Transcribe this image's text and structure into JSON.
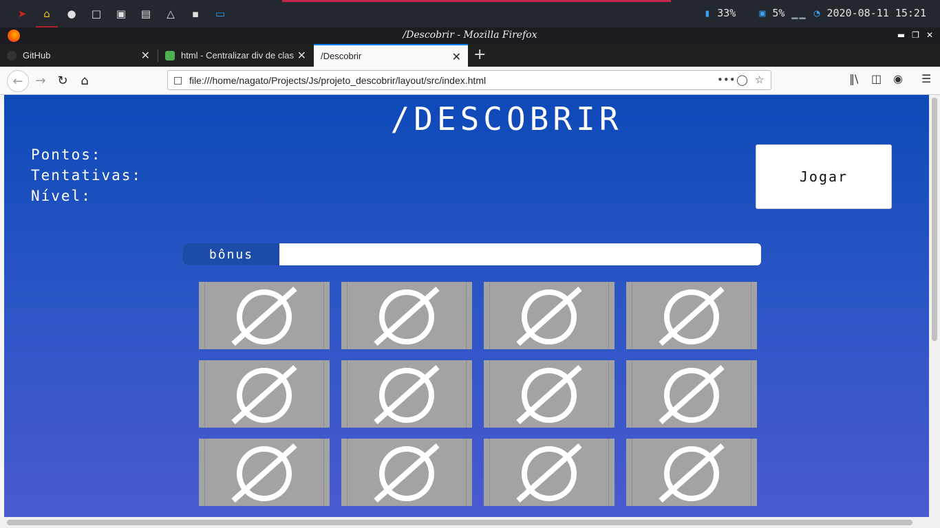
{
  "system_bar": {
    "battery": "33%",
    "cpu": "5%",
    "datetime": "2020-08-11 15:21"
  },
  "window": {
    "title": "/Descobrir - Mozilla Firefox"
  },
  "tabs": [
    {
      "label": "GitHub"
    },
    {
      "label": "html - Centralizar div de clas"
    },
    {
      "label": "/Descobrir"
    }
  ],
  "navbar": {
    "url": "file:///home/nagato/Projects/Js/projeto_descobrir/layout/src/index.html"
  },
  "page": {
    "title": "/DESCOBRIR",
    "stats": {
      "points_label": "Pontos:",
      "attempts_label": "Tentativas:",
      "level_label": "Nível:"
    },
    "play_button": "Jogar",
    "bonus_label": "bônus",
    "card_symbol": "Ø",
    "card_count": 12
  },
  "colors": {
    "page_top": "#0d49b8",
    "page_bottom": "#4a5ad0",
    "card": "#a3a3a3",
    "bonus_label_bg": "#1c4ca8"
  }
}
